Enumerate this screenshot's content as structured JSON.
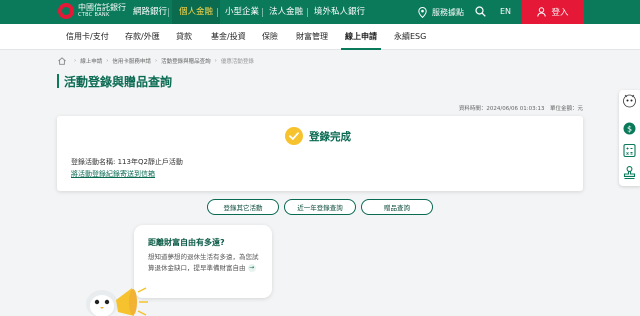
{
  "header": {
    "logo": {
      "name_cn": "中國信託銀行",
      "name_en": "CTBC BANK"
    },
    "nav": [
      "網路銀行",
      "個人金融",
      "小型企業",
      "法人金融",
      "境外私人銀行"
    ],
    "active_nav": "個人金融",
    "service_points": "服務據點",
    "language": "EN",
    "login_label": "登入"
  },
  "subnav": {
    "items": [
      "信用卡/支付",
      "存款/外匯",
      "貸款",
      "基金/投資",
      "保險",
      "財富管理",
      "線上申請",
      "永續ESG"
    ],
    "active": "線上申請"
  },
  "breadcrumb": [
    "線上申請",
    "信用卡服務申請",
    "活動登錄與贈品查詢",
    "優惠活動登錄"
  ],
  "page_title": "活動登錄與贈品查詢",
  "data_time": "資料時間：2024/06/06 01:03:13　單位金額：元",
  "result": {
    "status": "登錄完成",
    "event_line": "登錄活動名稱: 113年Q2靜止戶活動",
    "email_link": "將活動登錄紀錄寄送到信箱"
  },
  "actions": {
    "register_other": "登錄其它活動",
    "year_query": "近一年登錄查詢",
    "gift_query": "贈品查詢"
  },
  "promo": {
    "title": "距離財富自由有多遠?",
    "body": "想知道夢想的退休生活有多遠，為您試算退休金缺口，提早準備財富自由"
  },
  "colors": {
    "brand_green": "#0a7a5a",
    "brand_red": "#e51937",
    "check_yellow": "#f6c22e"
  },
  "rail_icons": [
    "mascot-icon",
    "money-icon",
    "calculator-icon",
    "stamp-icon"
  ]
}
